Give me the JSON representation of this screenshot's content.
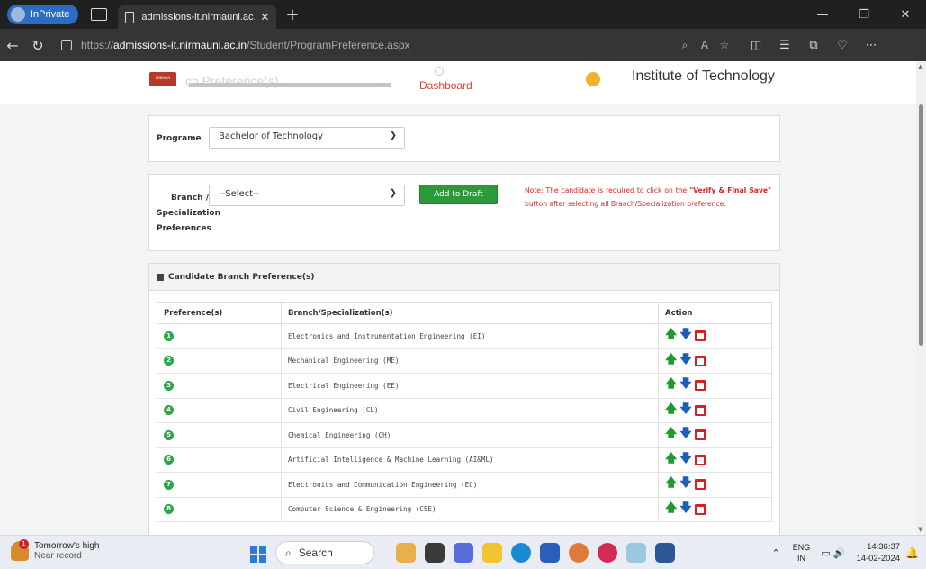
{
  "browser": {
    "inprivate_label": "InPrivate",
    "tab_title": "admissions-it.nirmauni.ac.in/Stud",
    "url_prefix": "https://",
    "url_host": "admissions-it.nirmauni.ac.in",
    "url_path": "/Student/ProgramPreference.aspx"
  },
  "header": {
    "logo_text": "NIRMA",
    "ghost_title": "ch Preference(s)",
    "dashboard_label": "Dashboard",
    "institute": "Institute of Technology"
  },
  "programme": {
    "label": "Programe",
    "selected": "Bachelor of Technology"
  },
  "branch": {
    "label_line1": "Branch /",
    "label_line2": "Specialization",
    "label_line3": "Preferences",
    "selected": "--Select--",
    "add_button": "Add to Draft",
    "note_prefix": "Note: The candidate is required to click on the ",
    "note_bold": "\"Verify & Final Save\"",
    "note_suffix": " button after selecting all Branch/Specialization preference."
  },
  "preferences": {
    "heading": "Candidate Branch Preference(s)",
    "columns": [
      "Preference(s)",
      "Branch/Specialization(s)",
      "Action"
    ],
    "rows": [
      {
        "num": "1",
        "branch": "Electronics and Instrumentation Engineering (EI)"
      },
      {
        "num": "2",
        "branch": "Mechanical Engineering (ME)"
      },
      {
        "num": "3",
        "branch": "Electrical Engineering (EE)"
      },
      {
        "num": "4",
        "branch": "Civil Engineering (CL)"
      },
      {
        "num": "5",
        "branch": "Chemical Engineering (CH)"
      },
      {
        "num": "6",
        "branch": "Artificial Intelligence & Machine Learning (AI&ML)"
      },
      {
        "num": "7",
        "branch": "Electronics and Communication Engineering (EC)"
      },
      {
        "num": "8",
        "branch": "Computer Science & Engineering (CSE)"
      }
    ]
  },
  "taskbar": {
    "weather_line1": "Tomorrow's high",
    "weather_line2": "Near record",
    "weather_badge": "1",
    "search_label": "Search",
    "lang1": "ENG",
    "lang2": "IN",
    "time": "14:36:37",
    "date": "14-02-2024"
  }
}
